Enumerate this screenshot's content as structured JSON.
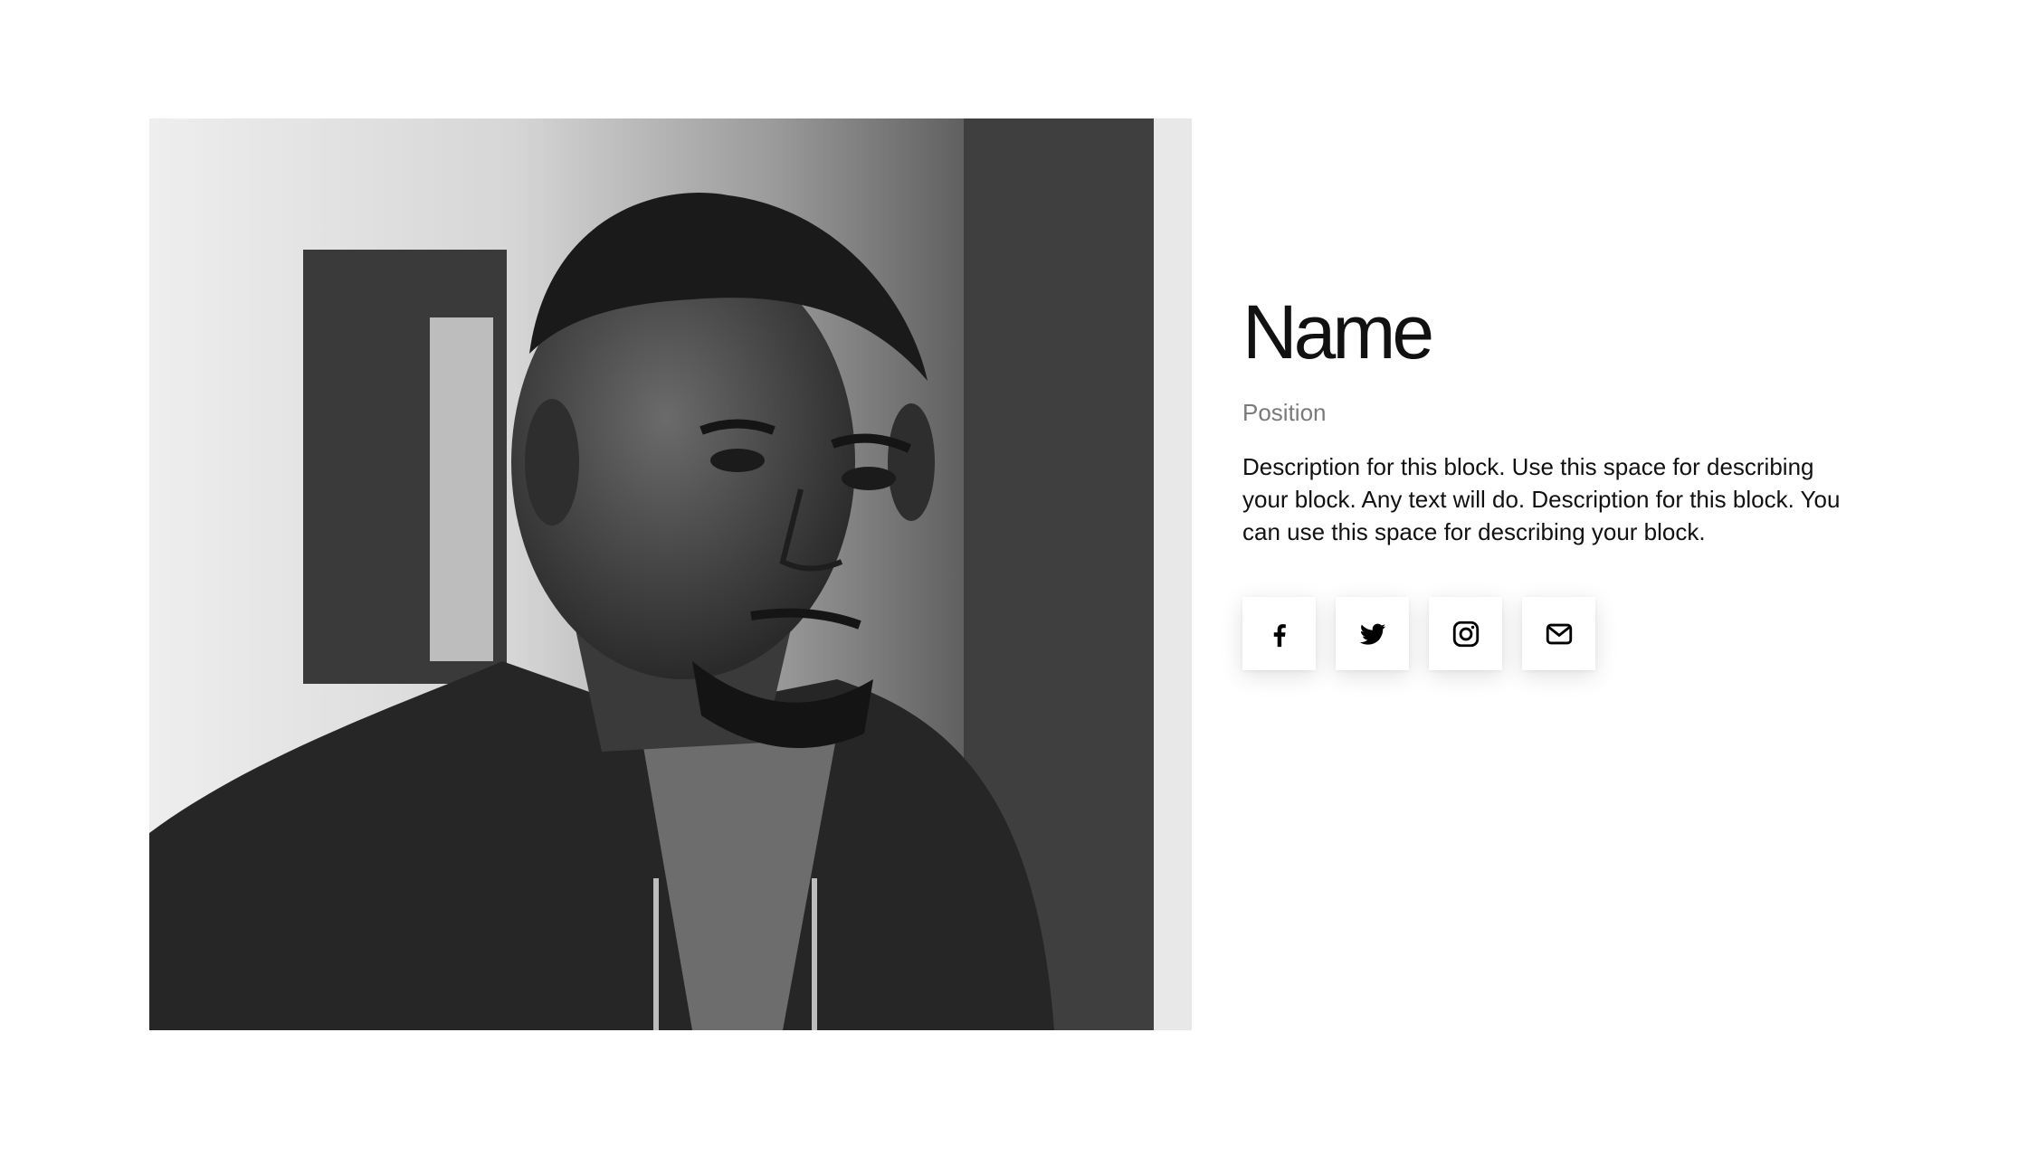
{
  "profile": {
    "name": "Name",
    "position": "Position",
    "description": "Description for this block. Use this space for describing your block. Any text will do. Description for this block. You can use this space for describing your block.",
    "photo_icon": "portrait-photo"
  },
  "socials": [
    {
      "icon": "facebook-icon"
    },
    {
      "icon": "twitter-icon"
    },
    {
      "icon": "instagram-icon"
    },
    {
      "icon": "email-icon"
    }
  ],
  "colors": {
    "text": "#111111",
    "muted": "#7a7a7a",
    "background": "#ffffff"
  }
}
